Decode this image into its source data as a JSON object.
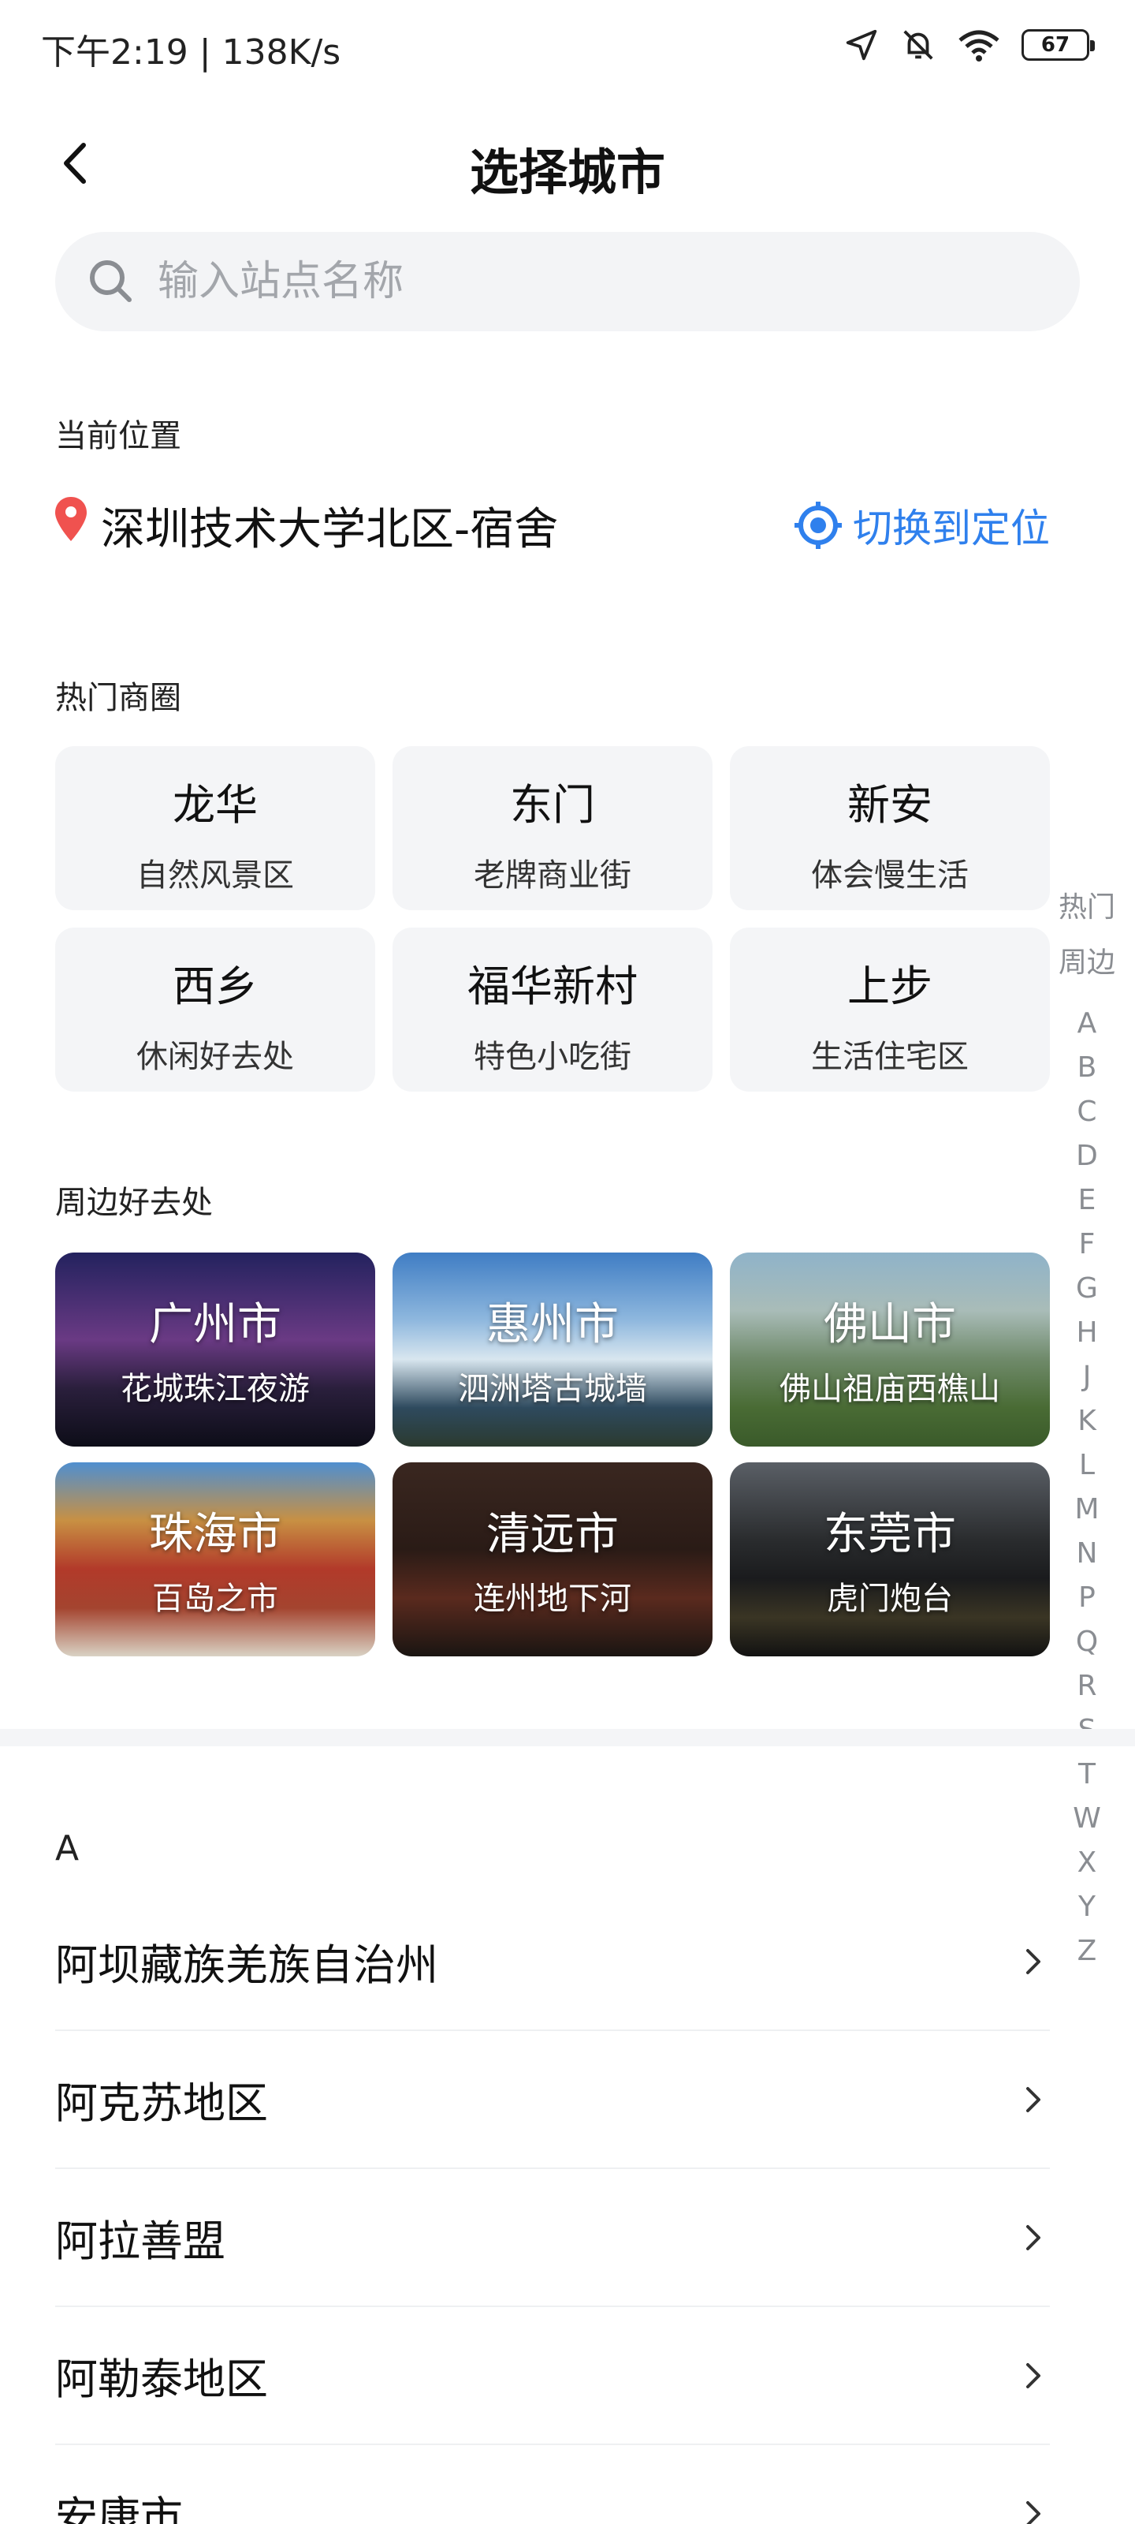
{
  "status_bar": {
    "time": "下午2:19 | 138K/s",
    "battery": "67"
  },
  "header": {
    "title": "选择城市"
  },
  "search": {
    "placeholder": "输入站点名称"
  },
  "current_location": {
    "label": "当前位置",
    "name": "深圳技术大学北区-宿舍",
    "switch_label": "切换到定位"
  },
  "hot_areas": {
    "label": "热门商圈",
    "items": [
      {
        "name": "龙华",
        "desc": "自然风景区"
      },
      {
        "name": "东门",
        "desc": "老牌商业街"
      },
      {
        "name": "新安",
        "desc": "体会慢生活"
      },
      {
        "name": "西乡",
        "desc": "休闲好去处"
      },
      {
        "name": "福华新村",
        "desc": "特色小吃街"
      },
      {
        "name": "上步",
        "desc": "生活住宅区"
      }
    ]
  },
  "nearby": {
    "label": "周边好去处",
    "items": [
      {
        "name": "广州市",
        "desc": "花城珠江夜游"
      },
      {
        "name": "惠州市",
        "desc": "泗洲塔古城墙"
      },
      {
        "name": "佛山市",
        "desc": "佛山祖庙西樵山"
      },
      {
        "name": "珠海市",
        "desc": "百岛之市"
      },
      {
        "name": "清远市",
        "desc": "连州地下河"
      },
      {
        "name": "东莞市",
        "desc": "虎门炮台"
      }
    ]
  },
  "index_bar": [
    "热门",
    "周边",
    "A",
    "B",
    "C",
    "D",
    "E",
    "F",
    "G",
    "H",
    "J",
    "K",
    "L",
    "M",
    "N",
    "P",
    "Q",
    "R",
    "S",
    "T",
    "W",
    "X",
    "Y",
    "Z"
  ],
  "city_list": {
    "letter": "A",
    "items": [
      "阿坝藏族羌族自治州",
      "阿克苏地区",
      "阿拉善盟",
      "阿勒泰地区",
      "安康市"
    ]
  }
}
